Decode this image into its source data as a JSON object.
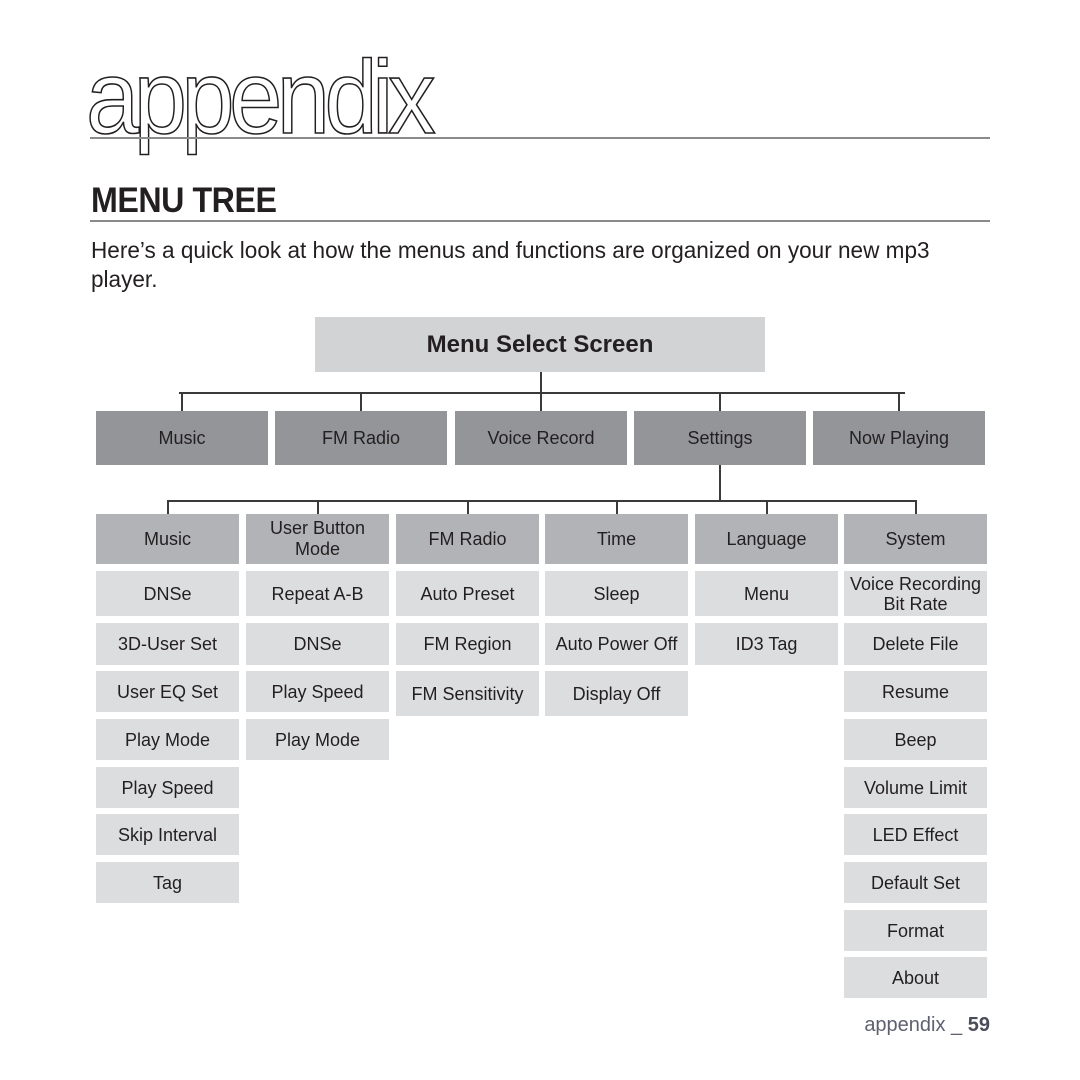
{
  "chapter": {
    "title": "appendix"
  },
  "section": {
    "title": "MENU TREE",
    "intro": "Here’s a quick look at how the menus and functions are organized on your new mp3 player."
  },
  "tree": {
    "root": "Menu Select Screen",
    "top_menus": [
      "Music",
      "FM Radio",
      "Voice Record",
      "Settings",
      "Now Playing"
    ],
    "settings_submenus": [
      {
        "label": "Music",
        "items": [
          "DNSe",
          "3D-User Set",
          "User EQ Set",
          "Play Mode",
          "Play Speed",
          "Skip Interval",
          "Tag"
        ]
      },
      {
        "label": "User Button Mode",
        "items": [
          "Repeat A-B",
          "DNSe",
          "Play Speed",
          "Play Mode"
        ]
      },
      {
        "label": "FM Radio",
        "items": [
          "Auto Preset",
          "FM Region",
          "FM Sensitivity"
        ]
      },
      {
        "label": "Time",
        "items": [
          "Sleep",
          "Auto Power Off",
          "Display Off"
        ]
      },
      {
        "label": "Language",
        "items": [
          "Menu",
          "ID3 Tag"
        ]
      },
      {
        "label": "System",
        "items": [
          "Voice Recording Bit Rate",
          "Delete File",
          "Resume",
          "Beep",
          "Volume Limit",
          "LED Effect",
          "Default Set",
          "Format",
          "About"
        ]
      }
    ]
  },
  "footer": {
    "section": "appendix _",
    "page": "59"
  }
}
